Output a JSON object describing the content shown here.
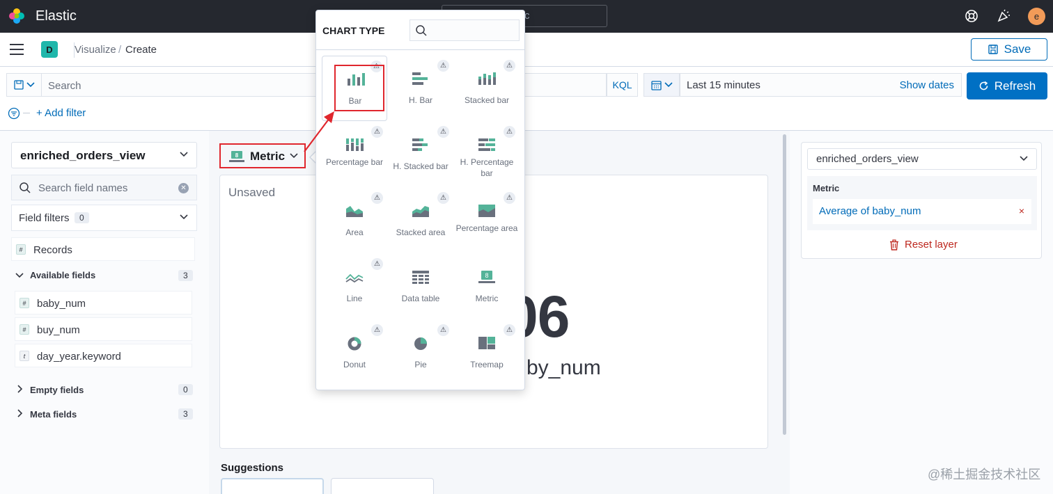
{
  "app": {
    "brand": "Elastic",
    "global_search_placeholder": "c"
  },
  "header": {
    "user_initial": "e",
    "help_icon": "help-icon",
    "news_icon": "newsfeed-icon"
  },
  "breadcrumb": {
    "space_initial": "D",
    "visualize": "Visualize",
    "separator": "/",
    "create": "Create"
  },
  "toolbar": {
    "save_label": "Save"
  },
  "query": {
    "search_placeholder": "Search",
    "kql": "KQL",
    "date_range": "Last 15 minutes",
    "show_dates": "Show dates",
    "refresh": "Refresh",
    "add_filter": "+ Add filter"
  },
  "sidebar": {
    "index_pattern": "enriched_orders_view",
    "search_placeholder": "Search field names",
    "field_filters": "Field filters",
    "field_filters_count": "0",
    "records": "Records",
    "available": {
      "label": "Available fields",
      "count": "3"
    },
    "fields": [
      {
        "type": "#",
        "name": "baby_num"
      },
      {
        "type": "#",
        "name": "buy_num"
      },
      {
        "type": "t",
        "name": "day_year.keyword"
      }
    ],
    "empty": {
      "label": "Empty fields",
      "count": "0"
    },
    "meta": {
      "label": "Meta fields",
      "count": "3"
    }
  },
  "workspace": {
    "switcher_label": "Metric",
    "unsaved": "Unsaved",
    "metric_value": "06",
    "metric_label": "by_num",
    "suggestions": "Suggestions"
  },
  "config": {
    "layer_index": "enriched_orders_view",
    "group_title": "Metric",
    "dimension": "Average of baby_num",
    "remove": "×",
    "reset": "Reset layer"
  },
  "popover": {
    "title": "CHART TYPE",
    "warning_glyph": "⚠",
    "tiles": [
      {
        "id": "bar",
        "label": "Bar"
      },
      {
        "id": "hbar",
        "label": "H. Bar"
      },
      {
        "id": "stacked-bar",
        "label": "Stacked bar"
      },
      {
        "id": "percentage-bar",
        "label": "Percentage bar"
      },
      {
        "id": "h-stacked-bar",
        "label": "H. Stacked bar"
      },
      {
        "id": "h-percentage-bar",
        "label": "H. Percentage bar"
      },
      {
        "id": "area",
        "label": "Area"
      },
      {
        "id": "stacked-area",
        "label": "Stacked area"
      },
      {
        "id": "percentage-area",
        "label": "Percentage area"
      },
      {
        "id": "line",
        "label": "Line"
      },
      {
        "id": "data-table",
        "label": "Data table"
      },
      {
        "id": "metric",
        "label": "Metric"
      },
      {
        "id": "donut",
        "label": "Donut"
      },
      {
        "id": "pie",
        "label": "Pie"
      },
      {
        "id": "treemap",
        "label": "Treemap"
      }
    ]
  },
  "colors": {
    "accent": "#006bb8",
    "chart_green": "#54b399",
    "chart_gray": "#69707d",
    "highlight": "#e0262d",
    "danger": "#bd271e"
  },
  "watermark": "@稀土掘金技术社区"
}
